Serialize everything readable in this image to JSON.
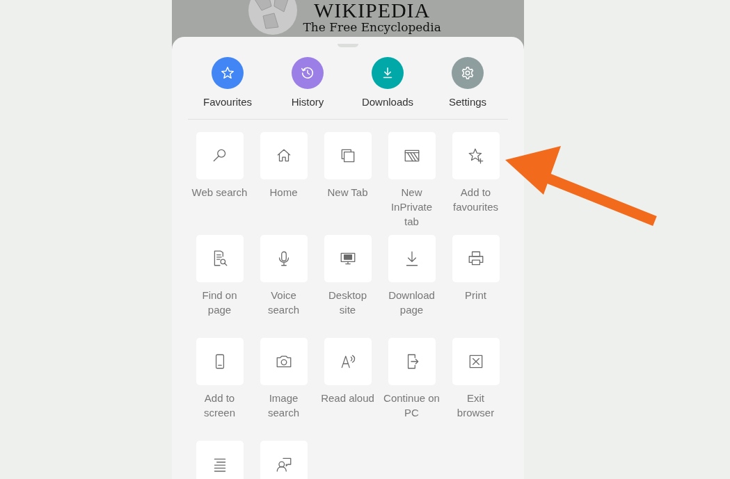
{
  "page_header": {
    "logo_title": "WIKIPEDIA",
    "tagline": "The Free Encyclopedia"
  },
  "quick_actions": [
    {
      "label": "Favourites",
      "color": "#4285f4"
    },
    {
      "label": "History",
      "color": "#9b7fe6"
    },
    {
      "label": "Downloads",
      "color": "#00a8a8"
    },
    {
      "label": "Settings",
      "color": "#8e9e9e"
    }
  ],
  "menu_items": [
    {
      "kind": "tile",
      "label": "Web search"
    },
    {
      "kind": "tile",
      "label": "Home"
    },
    {
      "kind": "tile",
      "label": "New Tab"
    },
    {
      "kind": "tile",
      "label": "New InPrivate tab"
    },
    {
      "kind": "tile",
      "label": "Add to favourites"
    },
    {
      "kind": "tile",
      "label": "Find on page"
    },
    {
      "kind": "tile",
      "label": "Voice search"
    },
    {
      "kind": "tile",
      "label": "Desktop site"
    },
    {
      "kind": "tile",
      "label": "Download page"
    },
    {
      "kind": "tile",
      "label": "Print"
    },
    {
      "kind": "tile",
      "label": "Add to screen"
    },
    {
      "kind": "tile",
      "label": "Image search"
    },
    {
      "kind": "tile",
      "label": "Read aloud"
    },
    {
      "kind": "tile",
      "label": "Continue on PC"
    },
    {
      "kind": "tile",
      "label": "Exit browser"
    },
    {
      "kind": "cut_off_tile"
    },
    {
      "kind": "cut_off_tile"
    }
  ]
}
